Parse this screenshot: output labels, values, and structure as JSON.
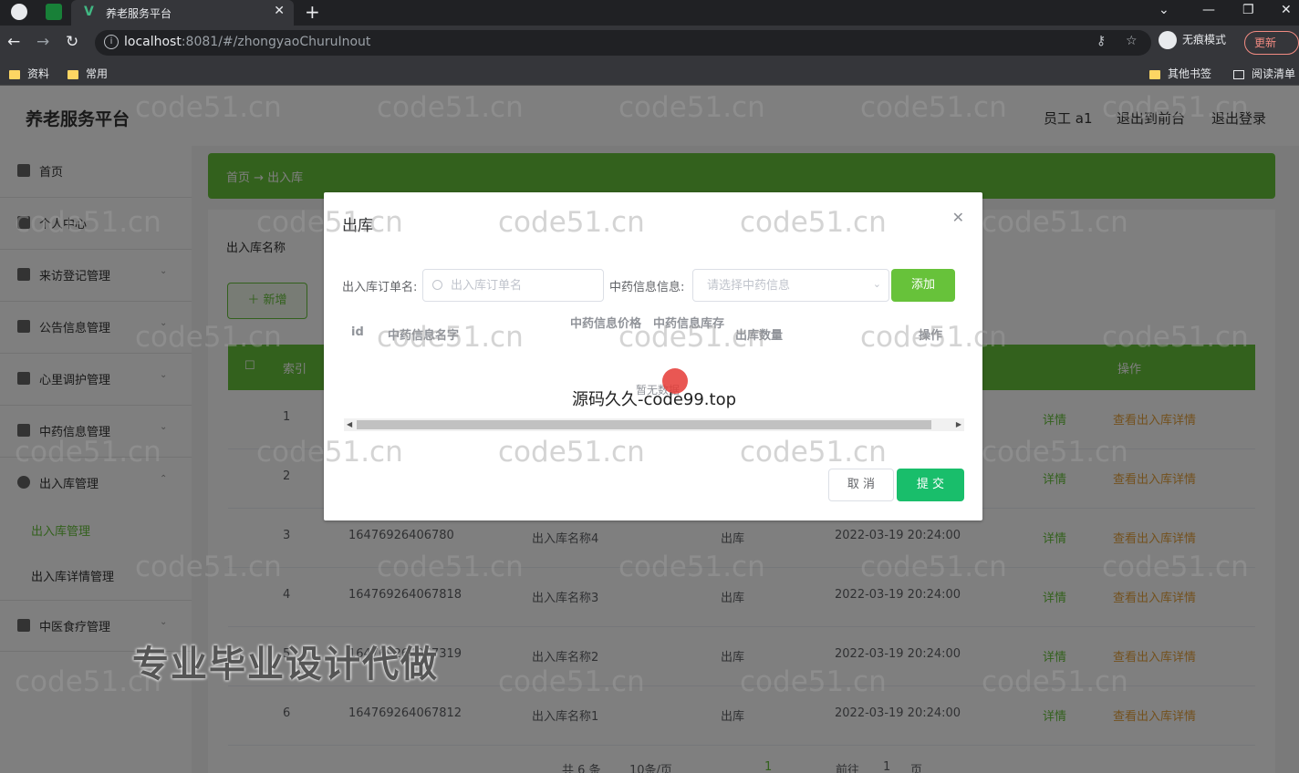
{
  "browser": {
    "tab_title": "养老服务平台",
    "url_host": "localhost",
    "url_rest": ":8081/#/zhongyaoChuruInout",
    "incognito_label": "无痕模式",
    "update_label": "更新",
    "bookmarks": [
      "资料",
      "常用"
    ],
    "bookmarks_right": [
      "其他书签",
      "阅读清单"
    ]
  },
  "app": {
    "title": "养老服务平台",
    "header_links": [
      "员工 a1",
      "退出到前台",
      "退出登录"
    ],
    "breadcrumb": "首页  →  出入库",
    "sidebar": [
      {
        "label": "首页"
      },
      {
        "label": "个人中心"
      },
      {
        "label": "来访登记管理"
      },
      {
        "label": "公告信息管理"
      },
      {
        "label": "心里调护管理"
      },
      {
        "label": "中药信息管理"
      },
      {
        "label": "出入库管理"
      },
      {
        "label": "中医食疗管理"
      }
    ],
    "submenu": [
      "出入库管理",
      "出入库详情管理"
    ],
    "search_label": "出入库名称",
    "add_button": "＋ 新增",
    "table_headers": {
      "select": "",
      "index": "索引",
      "action": "操作"
    },
    "rows": [
      {
        "idx": "1",
        "code": "",
        "name": "",
        "type": "",
        "time": "",
        "detail": "详情",
        "view": "查看出入库详情"
      },
      {
        "idx": "2",
        "code": "",
        "name": "",
        "type": "",
        "time": "",
        "detail": "详情",
        "view": "查看出入库详情"
      },
      {
        "idx": "3",
        "code": "16476926406780",
        "name": "出入库名称4",
        "type": "出库",
        "time": "2022-03-19 20:24:00",
        "detail": "详情",
        "view": "查看出入库详情"
      },
      {
        "idx": "4",
        "code": "164769264067818",
        "name": "出入库名称3",
        "type": "出库",
        "time": "2022-03-19 20:24:00",
        "detail": "详情",
        "view": "查看出入库详情"
      },
      {
        "idx": "5",
        "code": "164769264067319",
        "name": "出入库名称2",
        "type": "出库",
        "time": "2022-03-19 20:24:00",
        "detail": "详情",
        "view": "查看出入库详情"
      },
      {
        "idx": "6",
        "code": "164769264067812",
        "name": "出入库名称1",
        "type": "出库",
        "time": "2022-03-19 20:24:00",
        "detail": "详情",
        "view": "查看出入库详情"
      }
    ],
    "pager": {
      "total": "共 6 条",
      "size": "10条/页",
      "page": "1",
      "goto": "前往",
      "goto_page": "1",
      "page_unit": "页"
    }
  },
  "dialog": {
    "title": "出库",
    "order_label": "出入库订单名:",
    "order_placeholder": "出入库订单名",
    "medicine_label": "中药信息信息:",
    "medicine_placeholder": "请选择中药信息",
    "add_label": "添加",
    "columns": [
      "id",
      "中药信息名字",
      "中药信息价格",
      "中药信息库存",
      "出库数量",
      "操作"
    ],
    "empty_text": "暂无数据",
    "cancel_label": "取 消",
    "submit_label": "提 交"
  },
  "overlays": {
    "source_text": "源码久久-code99.top",
    "banner": "专业毕业设计代做",
    "watermark": "code51.cn"
  },
  "colors": {
    "accent": "#67c23a",
    "submit": "#19be6b",
    "browser_dark": "#202124"
  }
}
